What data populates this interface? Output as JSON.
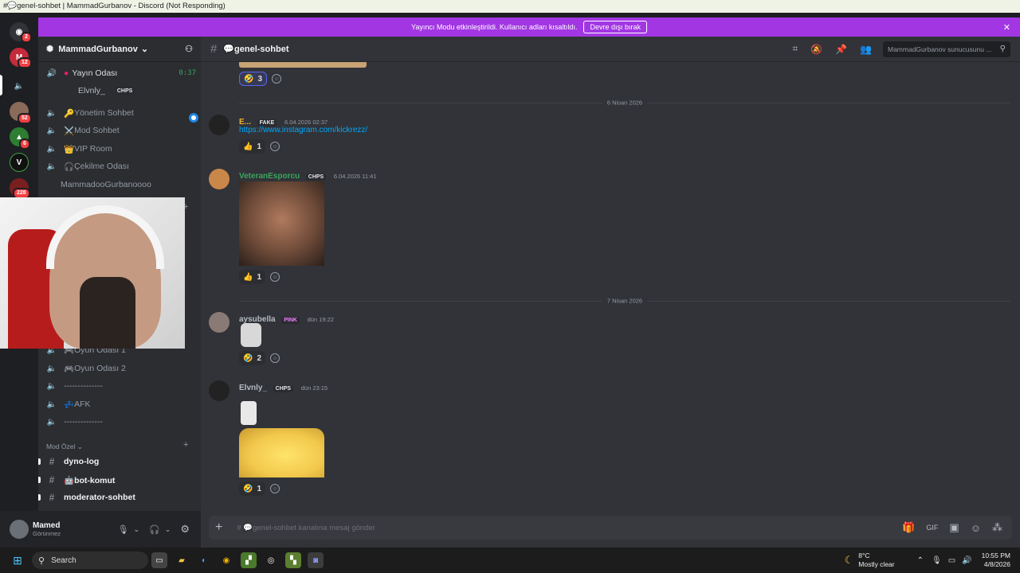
{
  "window": {
    "title": "#💬genel-sohbet | MammadGurbanov - Discord (Not Responding)"
  },
  "guilds": [
    {
      "name": "discord-home",
      "badge": "2"
    },
    {
      "name": "server-m",
      "badge": "12"
    },
    {
      "name": "server-speaker",
      "badge": ""
    },
    {
      "name": "server-avatar",
      "badge": "52"
    },
    {
      "name": "server-green",
      "badge": "6"
    },
    {
      "name": "server-v",
      "badge": ""
    },
    {
      "name": "server-red",
      "badge": "228"
    }
  ],
  "banner": {
    "text": "Yayıncı Modu etkinleştirildi. Kullanıcı adları kısaltıldı.",
    "button": "Devre dışı bırak",
    "close": "✕"
  },
  "server": {
    "name": "MammadGurbanov"
  },
  "voice_live": {
    "name": "Yayın Odası",
    "time": "0:37",
    "member": "Elvnly_",
    "member_tag": "CHPS"
  },
  "channels": [
    {
      "icon": "🔑",
      "label": "Yönetim Sohbet"
    },
    {
      "icon": "⚔️",
      "label": "Mod Sohbet"
    },
    {
      "icon": "👑",
      "label": "VIP Room"
    },
    {
      "icon": "🎧",
      "label": "Çekilme Odası"
    },
    {
      "icon": "",
      "label": "MammadooGurbanoooo"
    }
  ],
  "channels_lower": [
    {
      "icon": "🎮",
      "label": "Oyun Odası 1"
    },
    {
      "icon": "🎮",
      "label": "Oyun Odası 2"
    },
    {
      "icon": "",
      "label": "--------------"
    },
    {
      "icon": "💤",
      "label": "AFK"
    },
    {
      "icon": "",
      "label": "--------------"
    }
  ],
  "category": {
    "label": "Mod Özel ⌄"
  },
  "text_channels": [
    {
      "label": "dyno-log"
    },
    {
      "label": "🤖bot-komut"
    },
    {
      "label": "moderator-sohbet"
    }
  ],
  "user": {
    "name": "Mamed",
    "status": "Görünmez"
  },
  "channel_header": {
    "name": "💬genel-sohbet",
    "search_placeholder": "MammadGurbanov sunucusunu ..."
  },
  "messages": {
    "top_reaction": {
      "emoji": "🤣",
      "count": "3"
    },
    "date1": "6 Nisan 2026",
    "m1": {
      "user": "E...",
      "tag": "FAKE",
      "time": "6.04.2026 02:37",
      "link": "https://www.instagram.com/kickrezz/",
      "reaction_emoji": "👍",
      "reaction_count": "1"
    },
    "m2": {
      "user": "VeteranEsporcu",
      "tag": "CHPS",
      "time": "6.04.2026 11:41",
      "reaction_emoji": "👍",
      "reaction_count": "1"
    },
    "date2": "7 Nisan 2026",
    "m3": {
      "user": "aysubella",
      "tag": "PINK",
      "time": "dün 19:22",
      "reaction_emoji": "🤣",
      "reaction_count": "2"
    },
    "m4": {
      "user": "Elvnly_",
      "tag": "CHPS",
      "time": "dün 23:15",
      "reaction_emoji": "🤣",
      "reaction_count": "1"
    }
  },
  "composer": {
    "placeholder": "# 💬genel-sohbet kanalına mesaj gönder"
  },
  "taskbar": {
    "search": "Search",
    "weather_temp": "8°C",
    "weather_desc": "Mostly clear",
    "time": "10:55 PM",
    "date": "4/8/2026"
  },
  "colors": {
    "accent": "#5865f2",
    "banner": "#a236e3",
    "green_user": "#3ba55d",
    "link": "#00a8fc"
  }
}
